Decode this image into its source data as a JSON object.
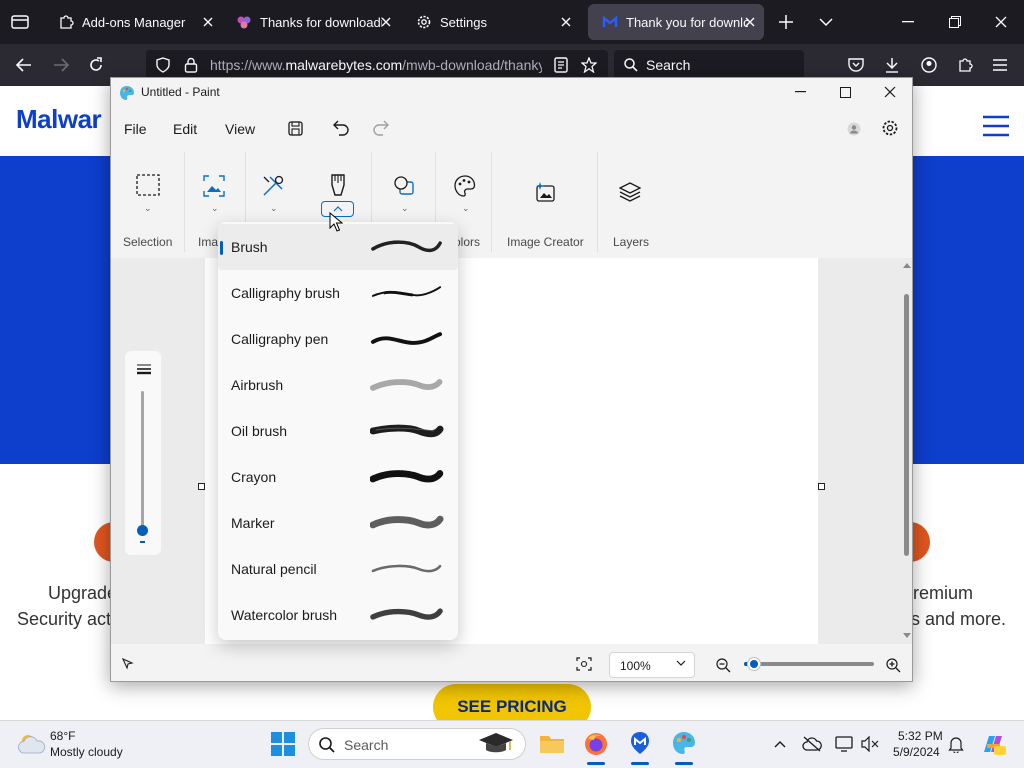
{
  "browser": {
    "tabs": [
      {
        "label": "Add-ons Manager",
        "icon": "puzzle-icon"
      },
      {
        "label": "Thanks for downloading",
        "icon": "flower-icon"
      },
      {
        "label": "Settings",
        "icon": "gear-icon"
      },
      {
        "label": "Thank you for downloading",
        "icon": "malwarebytes-icon",
        "active": true
      }
    ],
    "url_prefix": "https://www.",
    "url_domain": "malwarebytes.com",
    "url_path": "/mwb-download/thankyou",
    "search_placeholder": "Search"
  },
  "webpage": {
    "logo": "Malwar",
    "left_text_line1": "Upgrade",
    "left_text_line2": "Security act",
    "right_text_line1": "remium",
    "right_text_line2": "s and more.",
    "cta_label": "SEE PRICING",
    "colors": {
      "brand_blue": "#0d3ecc",
      "cta_yellow": "#f1c500",
      "accent_orange": "#e1561f"
    }
  },
  "paint": {
    "title": "Untitled - Paint",
    "menu": {
      "file": "File",
      "edit": "Edit",
      "view": "View"
    },
    "ribbon": {
      "selection": "Selection",
      "image": "Ima",
      "colors": "olors",
      "image_creator": "Image Creator",
      "layers": "Layers"
    },
    "brush_menu": {
      "items": [
        {
          "label": "Brush",
          "selected": true,
          "style": "brush"
        },
        {
          "label": "Calligraphy brush",
          "style": "calligraphy-brush"
        },
        {
          "label": "Calligraphy pen",
          "style": "calligraphy-pen"
        },
        {
          "label": "Airbrush",
          "style": "airbrush"
        },
        {
          "label": "Oil brush",
          "style": "oil-brush"
        },
        {
          "label": "Crayon",
          "style": "crayon"
        },
        {
          "label": "Marker",
          "style": "marker"
        },
        {
          "label": "Natural pencil",
          "style": "natural-pencil"
        },
        {
          "label": "Watercolor brush",
          "style": "watercolor-brush"
        }
      ]
    },
    "status": {
      "zoom": "100%",
      "zoom_slider_level": 0.08
    }
  },
  "taskbar": {
    "weather_temp": "68°F",
    "weather_desc": "Mostly cloudy",
    "search_placeholder": "Search",
    "time": "5:32 PM",
    "date": "5/9/2024"
  }
}
